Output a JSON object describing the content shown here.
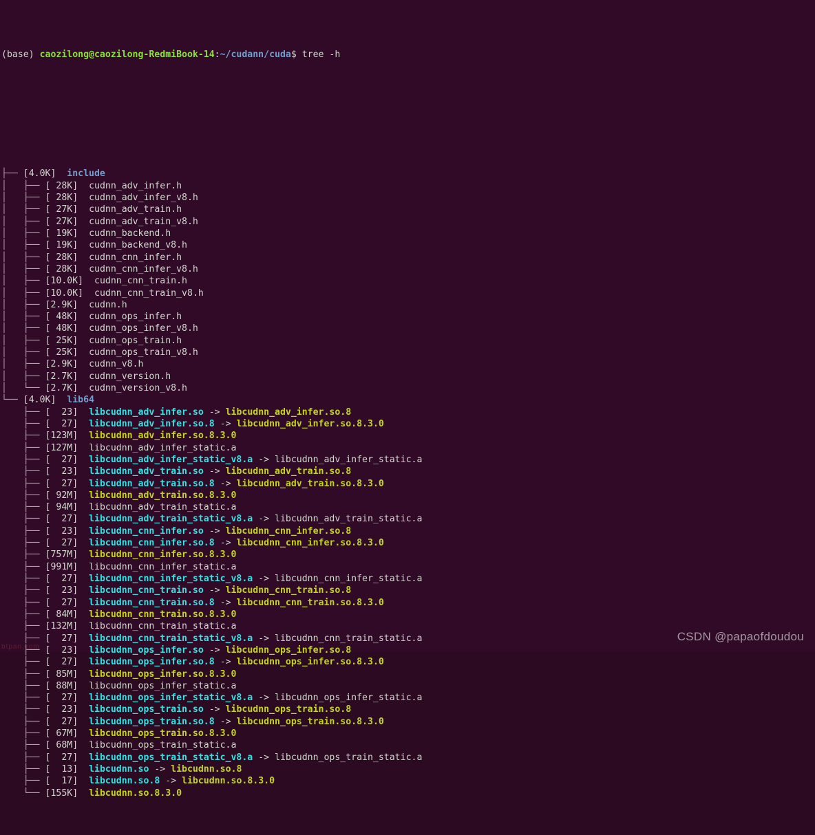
{
  "terminal": {
    "background_color": "#300a26",
    "prompt": {
      "env": "(base) ",
      "user_host": "caozilong@caozilong-RedmiBook-14",
      "separator": ":",
      "path": "~/cudann/cuda",
      "dollar": "$ ",
      "command": "tree -h"
    },
    "root": ".",
    "colors": {
      "white": "#d3d7cf",
      "green": "#8ae234",
      "blue": "#729fcf",
      "cyan": "#34e2e2",
      "yellow": "#c4d61c",
      "tree": "#b8a0b0"
    }
  },
  "tree": {
    "dirs": [
      {
        "size": "[4.0K]",
        "name": "include",
        "last": false,
        "entries": [
          {
            "size": "[ 28K]",
            "name": "cudnn_adv_infer.h",
            "type": "file"
          },
          {
            "size": "[ 28K]",
            "name": "cudnn_adv_infer_v8.h",
            "type": "file"
          },
          {
            "size": "[ 27K]",
            "name": "cudnn_adv_train.h",
            "type": "file"
          },
          {
            "size": "[ 27K]",
            "name": "cudnn_adv_train_v8.h",
            "type": "file"
          },
          {
            "size": "[ 19K]",
            "name": "cudnn_backend.h",
            "type": "file"
          },
          {
            "size": "[ 19K]",
            "name": "cudnn_backend_v8.h",
            "type": "file"
          },
          {
            "size": "[ 28K]",
            "name": "cudnn_cnn_infer.h",
            "type": "file"
          },
          {
            "size": "[ 28K]",
            "name": "cudnn_cnn_infer_v8.h",
            "type": "file"
          },
          {
            "size": "[10.0K]",
            "name": "cudnn_cnn_train.h",
            "type": "file"
          },
          {
            "size": "[10.0K]",
            "name": "cudnn_cnn_train_v8.h",
            "type": "file"
          },
          {
            "size": "[2.9K]",
            "name": "cudnn.h",
            "type": "file"
          },
          {
            "size": "[ 48K]",
            "name": "cudnn_ops_infer.h",
            "type": "file"
          },
          {
            "size": "[ 48K]",
            "name": "cudnn_ops_infer_v8.h",
            "type": "file"
          },
          {
            "size": "[ 25K]",
            "name": "cudnn_ops_train.h",
            "type": "file"
          },
          {
            "size": "[ 25K]",
            "name": "cudnn_ops_train_v8.h",
            "type": "file"
          },
          {
            "size": "[2.9K]",
            "name": "cudnn_v8.h",
            "type": "file"
          },
          {
            "size": "[2.7K]",
            "name": "cudnn_version.h",
            "type": "file"
          },
          {
            "size": "[2.7K]",
            "name": "cudnn_version_v8.h",
            "type": "file",
            "last": true
          }
        ]
      },
      {
        "size": "[4.0K]",
        "name": "lib64",
        "last": true,
        "entries": [
          {
            "size": "[  23]",
            "name": "libcudnn_adv_infer.so",
            "type": "link",
            "target": "libcudnn_adv_infer.so.8",
            "target_type": "so"
          },
          {
            "size": "[  27]",
            "name": "libcudnn_adv_infer.so.8",
            "type": "link",
            "target": "libcudnn_adv_infer.so.8.3.0",
            "target_type": "so"
          },
          {
            "size": "[123M]",
            "name": "libcudnn_adv_infer.so.8.3.0",
            "type": "so"
          },
          {
            "size": "[127M]",
            "name": "libcudnn_adv_infer_static.a",
            "type": "file"
          },
          {
            "size": "[  27]",
            "name": "libcudnn_adv_infer_static_v8.a",
            "type": "link",
            "target": "libcudnn_adv_infer_static.a",
            "target_type": "file"
          },
          {
            "size": "[  23]",
            "name": "libcudnn_adv_train.so",
            "type": "link",
            "target": "libcudnn_adv_train.so.8",
            "target_type": "so"
          },
          {
            "size": "[  27]",
            "name": "libcudnn_adv_train.so.8",
            "type": "link",
            "target": "libcudnn_adv_train.so.8.3.0",
            "target_type": "so"
          },
          {
            "size": "[ 92M]",
            "name": "libcudnn_adv_train.so.8.3.0",
            "type": "so"
          },
          {
            "size": "[ 94M]",
            "name": "libcudnn_adv_train_static.a",
            "type": "file"
          },
          {
            "size": "[  27]",
            "name": "libcudnn_adv_train_static_v8.a",
            "type": "link",
            "target": "libcudnn_adv_train_static.a",
            "target_type": "file"
          },
          {
            "size": "[  23]",
            "name": "libcudnn_cnn_infer.so",
            "type": "link",
            "target": "libcudnn_cnn_infer.so.8",
            "target_type": "so"
          },
          {
            "size": "[  27]",
            "name": "libcudnn_cnn_infer.so.8",
            "type": "link",
            "target": "libcudnn_cnn_infer.so.8.3.0",
            "target_type": "so"
          },
          {
            "size": "[757M]",
            "name": "libcudnn_cnn_infer.so.8.3.0",
            "type": "so"
          },
          {
            "size": "[991M]",
            "name": "libcudnn_cnn_infer_static.a",
            "type": "file"
          },
          {
            "size": "[  27]",
            "name": "libcudnn_cnn_infer_static_v8.a",
            "type": "link",
            "target": "libcudnn_cnn_infer_static.a",
            "target_type": "file"
          },
          {
            "size": "[  23]",
            "name": "libcudnn_cnn_train.so",
            "type": "link",
            "target": "libcudnn_cnn_train.so.8",
            "target_type": "so"
          },
          {
            "size": "[  27]",
            "name": "libcudnn_cnn_train.so.8",
            "type": "link",
            "target": "libcudnn_cnn_train.so.8.3.0",
            "target_type": "so"
          },
          {
            "size": "[ 84M]",
            "name": "libcudnn_cnn_train.so.8.3.0",
            "type": "so"
          },
          {
            "size": "[132M]",
            "name": "libcudnn_cnn_train_static.a",
            "type": "file"
          },
          {
            "size": "[  27]",
            "name": "libcudnn_cnn_train_static_v8.a",
            "type": "link",
            "target": "libcudnn_cnn_train_static.a",
            "target_type": "file"
          },
          {
            "size": "[  23]",
            "name": "libcudnn_ops_infer.so",
            "type": "link",
            "target": "libcudnn_ops_infer.so.8",
            "target_type": "so"
          },
          {
            "size": "[  27]",
            "name": "libcudnn_ops_infer.so.8",
            "type": "link",
            "target": "libcudnn_ops_infer.so.8.3.0",
            "target_type": "so"
          },
          {
            "size": "[ 85M]",
            "name": "libcudnn_ops_infer.so.8.3.0",
            "type": "so"
          },
          {
            "size": "[ 88M]",
            "name": "libcudnn_ops_infer_static.a",
            "type": "file"
          },
          {
            "size": "[  27]",
            "name": "libcudnn_ops_infer_static_v8.a",
            "type": "link",
            "target": "libcudnn_ops_infer_static.a",
            "target_type": "file"
          },
          {
            "size": "[  23]",
            "name": "libcudnn_ops_train.so",
            "type": "link",
            "target": "libcudnn_ops_train.so.8",
            "target_type": "so"
          },
          {
            "size": "[  27]",
            "name": "libcudnn_ops_train.so.8",
            "type": "link",
            "target": "libcudnn_ops_train.so.8.3.0",
            "target_type": "so"
          },
          {
            "size": "[ 67M]",
            "name": "libcudnn_ops_train.so.8.3.0",
            "type": "so"
          },
          {
            "size": "[ 68M]",
            "name": "libcudnn_ops_train_static.a",
            "type": "file"
          },
          {
            "size": "[  27]",
            "name": "libcudnn_ops_train_static_v8.a",
            "type": "link",
            "target": "libcudnn_ops_train_static.a",
            "target_type": "file"
          },
          {
            "size": "[  13]",
            "name": "libcudnn.so",
            "type": "link",
            "target": "libcudnn.so.8",
            "target_type": "so"
          },
          {
            "size": "[  17]",
            "name": "libcudnn.so.8",
            "type": "link",
            "target": "libcudnn.so.8.3.0",
            "target_type": "so"
          },
          {
            "size": "[155K]",
            "name": "libcudnn.so.8.3.0",
            "type": "so",
            "last": true
          }
        ]
      }
    ]
  },
  "watermarks": {
    "csdn": "CSDN @papaofdoudou",
    "corner": "btpan.com"
  }
}
